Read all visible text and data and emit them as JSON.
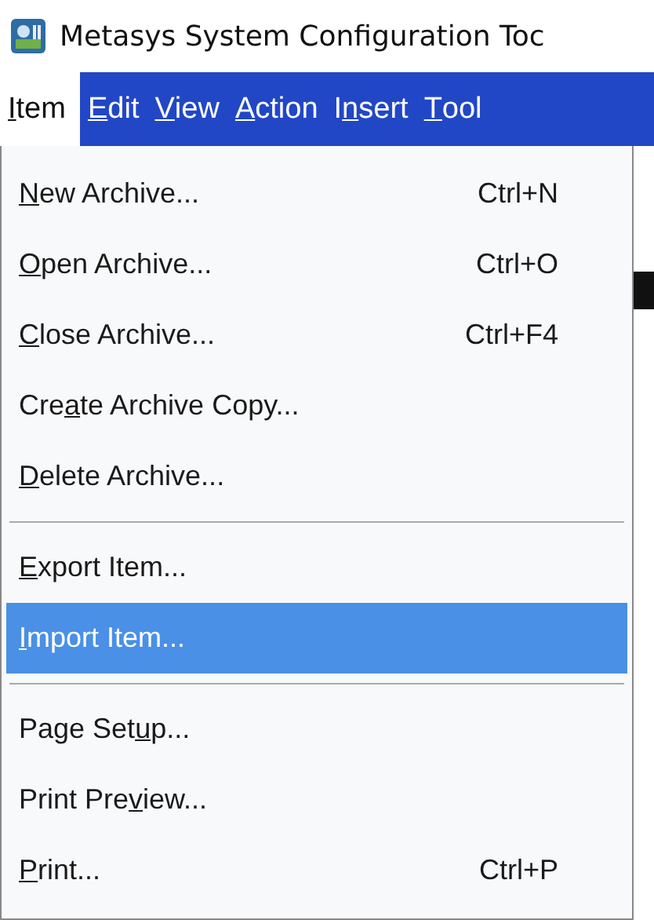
{
  "window": {
    "title": "Metasys System Configuration Toc"
  },
  "menubar": [
    {
      "label": {
        "key": "I",
        "post": "tem"
      },
      "selected": true
    },
    {
      "label": {
        "key": "E",
        "post": "dit"
      },
      "selected": false
    },
    {
      "label": {
        "key": "V",
        "post": "iew"
      },
      "selected": false
    },
    {
      "label": {
        "key": "A",
        "post": "ction"
      },
      "selected": false
    },
    {
      "label": {
        "pre": "I",
        "key": "n",
        "post": "sert"
      },
      "selected": false
    },
    {
      "label": {
        "key": "T",
        "post": "ool"
      },
      "selected": false
    }
  ],
  "menu": [
    {
      "kind": "item",
      "label": {
        "key": "N",
        "post": "ew Archive..."
      },
      "shortcut": "Ctrl+N",
      "selected": false
    },
    {
      "kind": "item",
      "label": {
        "key": "O",
        "post": "pen Archive..."
      },
      "shortcut": "Ctrl+O",
      "selected": false
    },
    {
      "kind": "item",
      "label": {
        "key": "C",
        "post": "lose Archive..."
      },
      "shortcut": "Ctrl+F4",
      "selected": false
    },
    {
      "kind": "item",
      "label": {
        "pre": "Cre",
        "key": "a",
        "post": "te Archive Copy..."
      },
      "selected": false
    },
    {
      "kind": "item",
      "label": {
        "key": "D",
        "post": "elete Archive..."
      },
      "selected": false
    },
    {
      "kind": "separator"
    },
    {
      "kind": "item",
      "label": {
        "key": "E",
        "post": "xport Item..."
      },
      "selected": false
    },
    {
      "kind": "item",
      "label": {
        "key": "I",
        "post": "mport Item..."
      },
      "selected": true
    },
    {
      "kind": "separator"
    },
    {
      "kind": "item",
      "label": {
        "pre": "Page Set",
        "key": "u",
        "post": "p..."
      },
      "selected": false
    },
    {
      "kind": "item",
      "label": {
        "pre": "Print Pre",
        "key": "v",
        "post": "iew..."
      },
      "selected": false
    },
    {
      "kind": "item",
      "label": {
        "key": "P",
        "post": "rint..."
      },
      "shortcut": "Ctrl+P",
      "selected": false
    }
  ]
}
